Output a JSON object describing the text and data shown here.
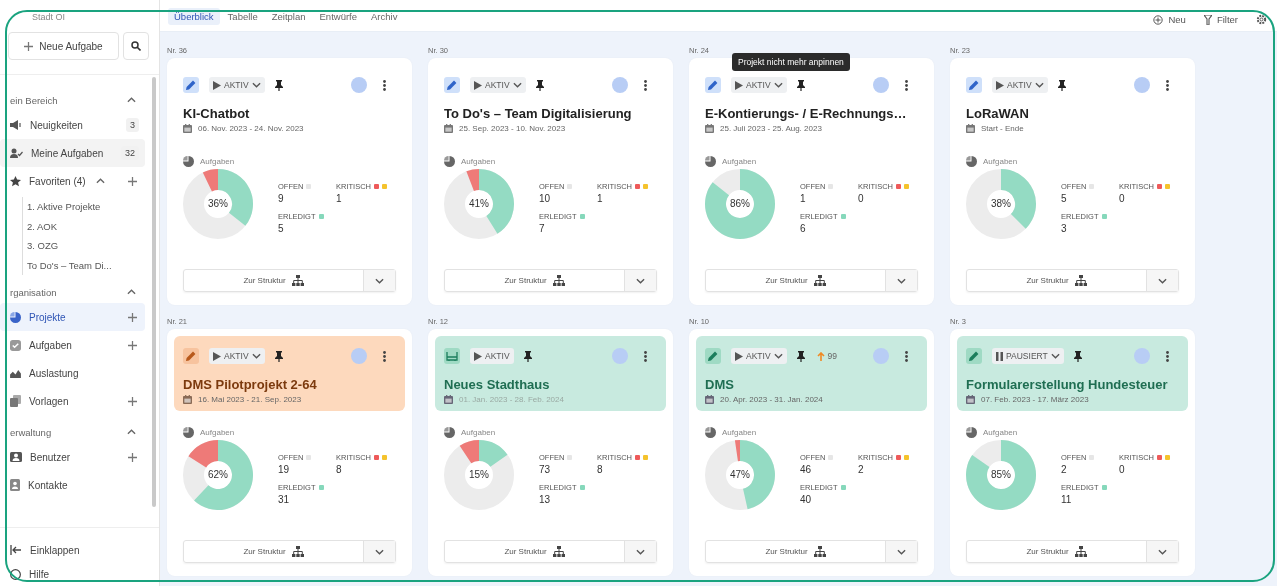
{
  "sidebar": {
    "workspace": "Stadt OI",
    "new_task_button": "Neue Aufgabe",
    "sections": [
      {
        "title": "ein Bereich",
        "expanded": true,
        "items": [
          {
            "label": "Neuigkeiten",
            "kind": "news",
            "count": "3",
            "selected": false,
            "addable": false
          },
          {
            "label": "Meine Aufgaben",
            "kind": "mytasks",
            "count": "32",
            "selected": false,
            "highlighted": true,
            "addable": false
          },
          {
            "label": "Favoriten (4)",
            "kind": "star",
            "selected": false,
            "addable": true,
            "expanded": true,
            "children": [
              {
                "label": "1. Aktive Projekte"
              },
              {
                "label": "2. AOK"
              },
              {
                "label": "3. OZG"
              },
              {
                "label": "To Do's – Team Di..."
              }
            ]
          }
        ]
      },
      {
        "title": "rganisation",
        "expanded": true,
        "items": [
          {
            "label": "Projekte",
            "kind": "pie",
            "selected": true,
            "addable": true
          },
          {
            "label": "Aufgaben",
            "kind": "check",
            "selected": false,
            "addable": true
          },
          {
            "label": "Auslastung",
            "kind": "chart",
            "selected": false,
            "addable": false
          },
          {
            "label": "Vorlagen",
            "kind": "copy",
            "selected": false,
            "addable": true
          }
        ]
      },
      {
        "title": "erwaltung",
        "expanded": true,
        "items": [
          {
            "label": "Benutzer",
            "kind": "user",
            "selected": false,
            "addable": true
          },
          {
            "label": "Kontakte",
            "kind": "contact",
            "selected": false,
            "addable": false
          }
        ]
      }
    ],
    "footer": [
      {
        "label": "Einklappen",
        "kind": "collapse"
      },
      {
        "label": "Hilfe",
        "kind": "help"
      }
    ]
  },
  "tabs": [
    {
      "label": "Überblick",
      "selected": true
    },
    {
      "label": "Tabelle",
      "selected": false
    },
    {
      "label": "Zeitplan",
      "selected": false
    },
    {
      "label": "Entwürfe",
      "selected": false
    },
    {
      "label": "Archiv",
      "selected": false
    }
  ],
  "actions": [
    {
      "label": "Neu",
      "kind": "new"
    },
    {
      "label": "Filter",
      "kind": "filter"
    },
    {
      "kind": "settings"
    }
  ],
  "projects": [
    {
      "number": "Nr. 36",
      "title": "KI-Chatbot",
      "dates": "06. Nov. 2023 - 24. Nov. 2023",
      "color": "#ffffff",
      "kind": "pencil",
      "status": {
        "label": "AKTIV",
        "kind": "play",
        "dropdown": true
      },
      "pinned": true,
      "section_label": "Aufgaben",
      "percent": "36%",
      "stats": [
        {
          "label": "OFFEN",
          "value": "9",
          "kind": "open"
        },
        {
          "label": "KRITISCH",
          "value": "1",
          "kind": "critical"
        },
        {
          "label": "ERLEDIGT",
          "value": "5",
          "kind": "done"
        }
      ],
      "structure_button": "Zur Struktur"
    },
    {
      "number": "Nr. 30",
      "title": "To Do's – Team Digitalisierung",
      "dates": "25. Sep. 2023 - 10. Nov. 2023",
      "color": "#ffffff",
      "kind": "pencil",
      "status": {
        "label": "AKTIV",
        "kind": "play",
        "dropdown": true
      },
      "pinned": true,
      "section_label": "Aufgaben",
      "percent": "41%",
      "stats": [
        {
          "label": "OFFEN",
          "value": "10",
          "kind": "open"
        },
        {
          "label": "KRITISCH",
          "value": "1",
          "kind": "critical"
        },
        {
          "label": "ERLEDIGT",
          "value": "7",
          "kind": "done"
        }
      ],
      "structure_button": "Zur Struktur"
    },
    {
      "number": "Nr. 24",
      "title": "E-Kontierungs- / E-Rechnungs…",
      "dates": "25. Juli 2023 - 25. Aug. 2023",
      "color": "#ffffff",
      "kind": "pencil",
      "status": {
        "label": "AKTIV",
        "kind": "play",
        "dropdown": true
      },
      "pinned": true,
      "tooltip": "Projekt nicht mehr anpinnen",
      "section_label": "Aufgaben",
      "percent": "86%",
      "stats": [
        {
          "label": "OFFEN",
          "value": "1",
          "kind": "open"
        },
        {
          "label": "KRITISCH",
          "value": "0",
          "kind": "critical"
        },
        {
          "label": "ERLEDIGT",
          "value": "6",
          "kind": "done"
        }
      ],
      "structure_button": "Zur Struktur"
    },
    {
      "number": "Nr. 23",
      "title": "LoRaWAN",
      "dates": "Start - Ende",
      "color": "#ffffff",
      "kind": "pencil",
      "status": {
        "label": "AKTIV",
        "kind": "play",
        "dropdown": true
      },
      "pinned": true,
      "section_label": "Aufgaben",
      "percent": "38%",
      "stats": [
        {
          "label": "OFFEN",
          "value": "5",
          "kind": "open"
        },
        {
          "label": "KRITISCH",
          "value": "0",
          "kind": "critical"
        },
        {
          "label": "ERLEDIGT",
          "value": "3",
          "kind": "done"
        }
      ],
      "structure_button": "Zur Struktur"
    },
    {
      "number": "Nr. 21",
      "title": "DMS Pilotprojekt 2-64",
      "dates": "16. Mai 2023 - 21. Sep. 2023",
      "color": "#fdd9bd",
      "kind": "pencil",
      "status": {
        "label": "AKTIV",
        "kind": "play",
        "dropdown": true
      },
      "pinned": true,
      "section_label": "Aufgaben",
      "percent": "62%",
      "stats": [
        {
          "label": "OFFEN",
          "value": "19",
          "kind": "open"
        },
        {
          "label": "KRITISCH",
          "value": "8",
          "kind": "critical"
        },
        {
          "label": "ERLEDIGT",
          "value": "31",
          "kind": "done"
        }
      ],
      "structure_button": "Zur Struktur"
    },
    {
      "number": "Nr. 12",
      "title": "Neues Stadthaus",
      "dates": "01. Jan. 2023 - 28. Feb. 2024",
      "color": "#c8eadf",
      "kind": "board",
      "status": {
        "label": "AKTIV",
        "kind": "play",
        "dropdown": false
      },
      "pinned": true,
      "section_label": "Aufgaben",
      "percent": "15%",
      "stats": [
        {
          "label": "OFFEN",
          "value": "73",
          "kind": "open"
        },
        {
          "label": "KRITISCH",
          "value": "8",
          "kind": "critical"
        },
        {
          "label": "ERLEDIGT",
          "value": "13",
          "kind": "done"
        }
      ],
      "structure_button": "Zur Struktur"
    },
    {
      "number": "Nr. 10",
      "title": "DMS",
      "dates": "20. Apr. 2023 - 31. Jan. 2024",
      "color": "#c8eadf",
      "kind": "pencil",
      "status": {
        "label": "AKTIV",
        "kind": "play",
        "dropdown": true
      },
      "pinned": true,
      "priority": "99",
      "section_label": "Aufgaben",
      "percent": "47%",
      "stats": [
        {
          "label": "OFFEN",
          "value": "46",
          "kind": "open"
        },
        {
          "label": "KRITISCH",
          "value": "2",
          "kind": "critical"
        },
        {
          "label": "ERLEDIGT",
          "value": "40",
          "kind": "done"
        }
      ],
      "structure_button": "Zur Struktur"
    },
    {
      "number": "Nr. 3",
      "title": "Formularerstellung Hundesteuer",
      "dates": "07. Feb. 2023 - 17. März 2023",
      "color": "#c8eadf",
      "kind": "pencil",
      "status": {
        "label": "PAUSIERT",
        "kind": "pause",
        "dropdown": true
      },
      "pinned": true,
      "section_label": "Aufgaben",
      "percent": "85%",
      "stats": [
        {
          "label": "OFFEN",
          "value": "2",
          "kind": "open"
        },
        {
          "label": "KRITISCH",
          "value": "0",
          "kind": "critical"
        },
        {
          "label": "ERLEDIGT",
          "value": "11",
          "kind": "done"
        }
      ],
      "structure_button": "Zur Struktur"
    }
  ]
}
